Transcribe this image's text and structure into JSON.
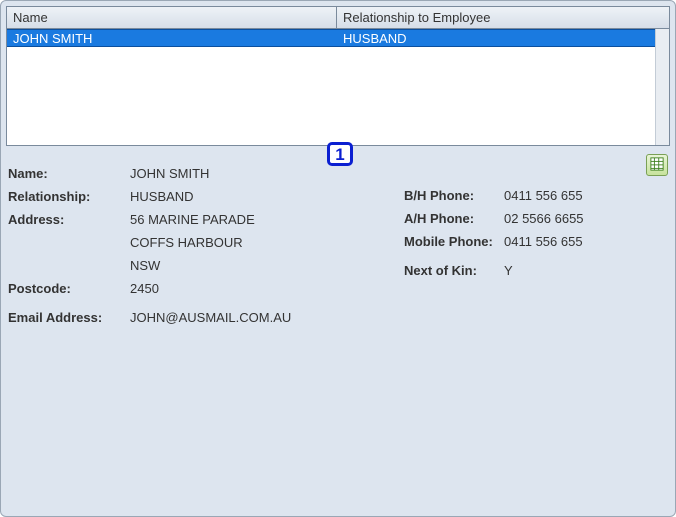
{
  "grid": {
    "headers": {
      "name": "Name",
      "relationship": "Relationship to Employee"
    },
    "rows": [
      {
        "name": "JOHN SMITH",
        "relationship": "HUSBAND",
        "selected": true
      }
    ]
  },
  "annotation": "1",
  "details": {
    "labels": {
      "name": "Name:",
      "relationship": "Relationship:",
      "address": "Address:",
      "postcode": "Postcode:",
      "email": "Email Address:",
      "bh_phone": "B/H Phone:",
      "ah_phone": "A/H Phone:",
      "mobile": "Mobile Phone:",
      "nok": "Next of Kin:"
    },
    "values": {
      "name": "JOHN SMITH",
      "relationship": "HUSBAND",
      "address1": "56 MARINE PARADE",
      "address2": "COFFS HARBOUR",
      "address3": "NSW",
      "postcode": "2450",
      "email": "JOHN@AUSMAIL.COM.AU",
      "bh_phone": "0411 556 655",
      "ah_phone": "02 5566 6655",
      "mobile": "0411 556 655",
      "nok": "Y"
    }
  }
}
